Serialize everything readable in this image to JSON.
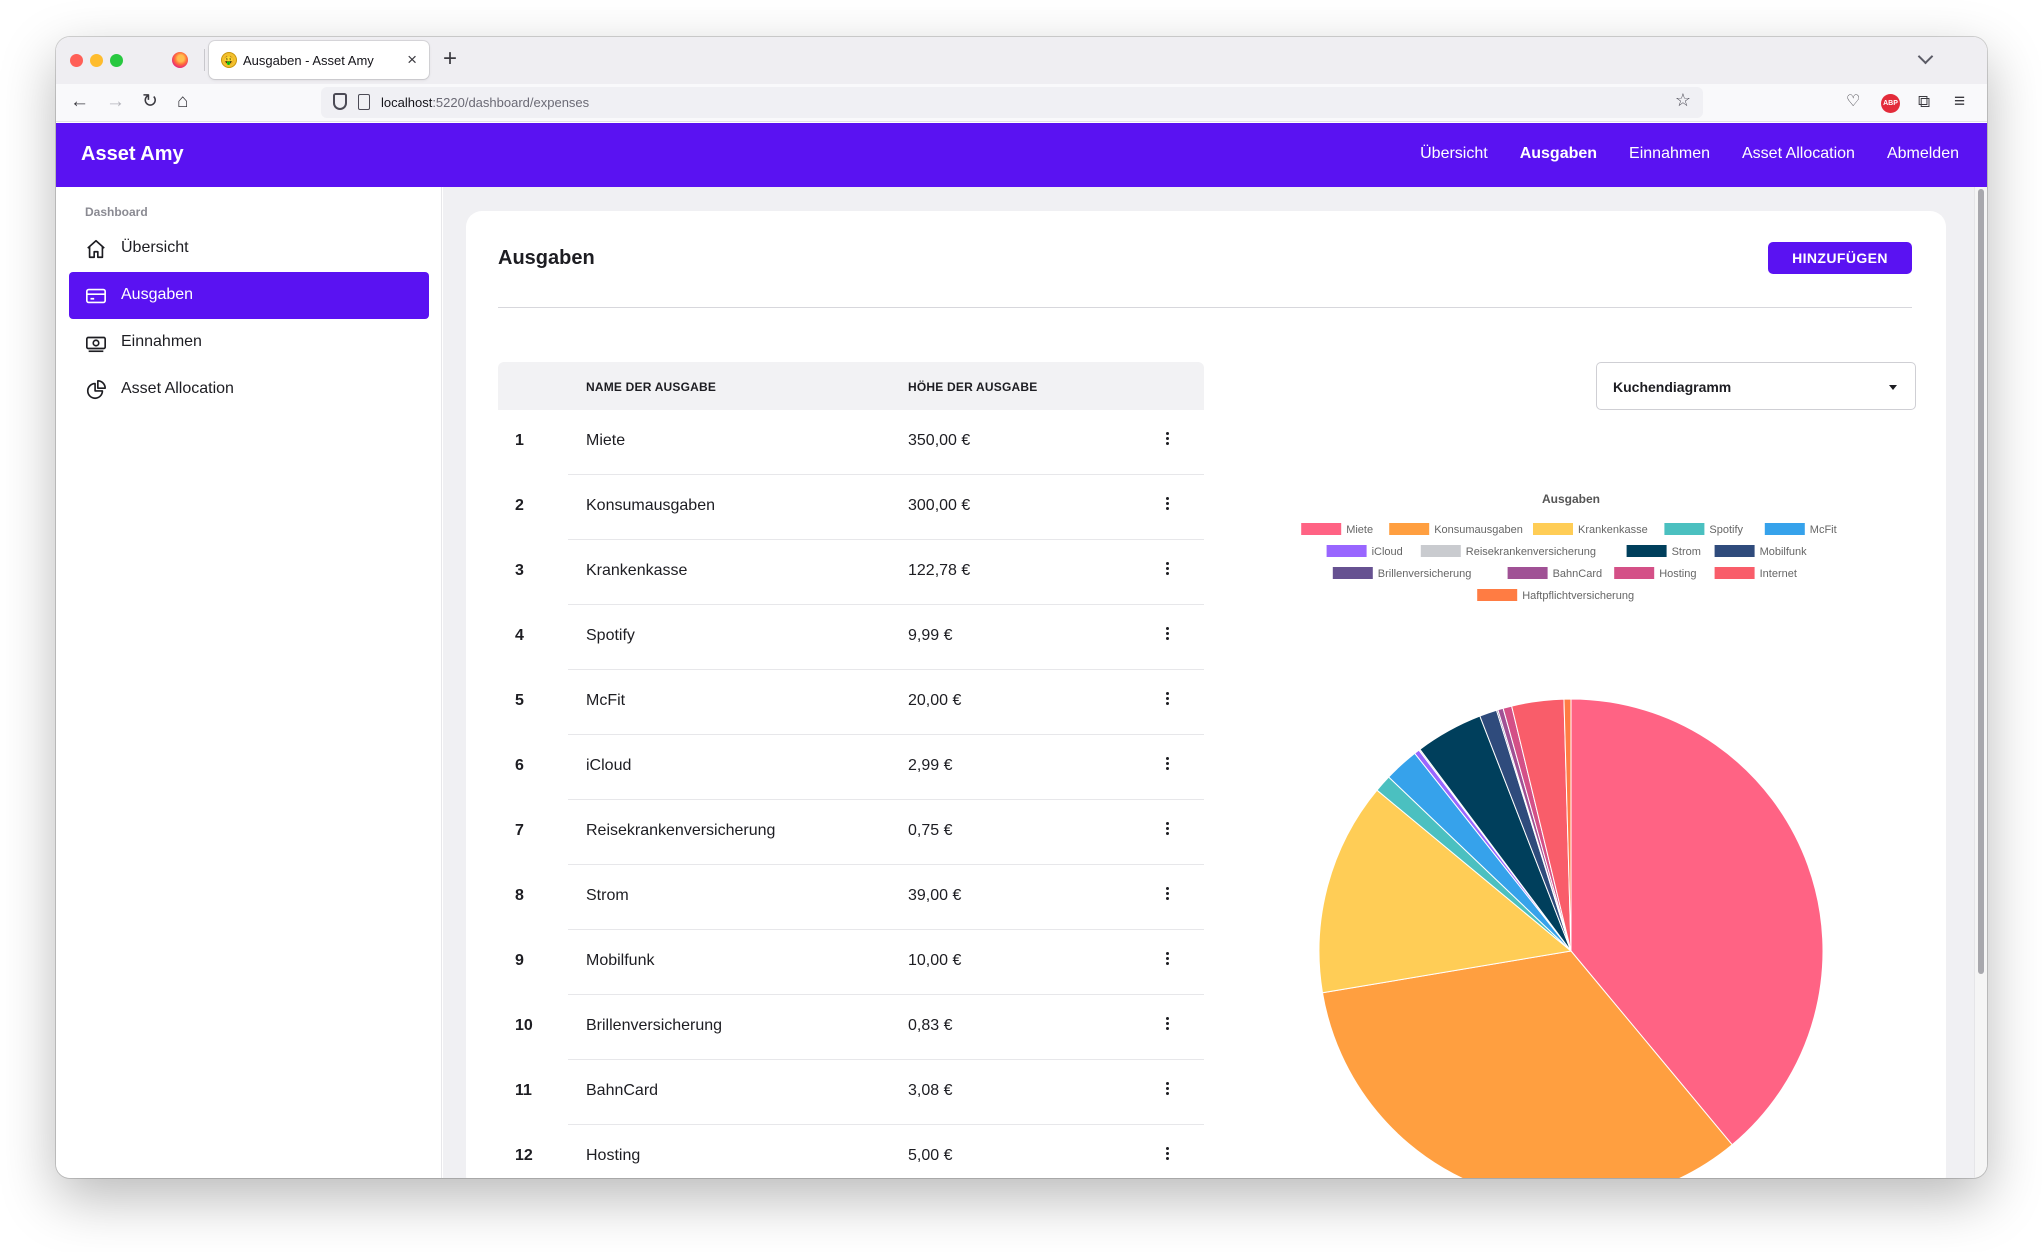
{
  "browser": {
    "tab_title": "Ausgaben - Asset Amy",
    "tab_favicon": "🤑",
    "url_host": "localhost",
    "url_path": ":5220/dashboard/expenses"
  },
  "app": {
    "brand": "Asset Amy",
    "topnav": [
      "Übersicht",
      "Ausgaben",
      "Einnahmen",
      "Asset Allocation",
      "Abmelden"
    ],
    "topnav_active": "Ausgaben"
  },
  "sidebar": {
    "heading": "Dashboard",
    "items": [
      {
        "label": "Übersicht",
        "icon": "home-icon",
        "active": false
      },
      {
        "label": "Ausgaben",
        "icon": "credit-card-icon",
        "active": true
      },
      {
        "label": "Einnahmen",
        "icon": "banknote-icon",
        "active": false
      },
      {
        "label": "Asset Allocation",
        "icon": "pie-chart-icon",
        "active": false
      }
    ]
  },
  "page": {
    "title": "Ausgaben",
    "add_button": "HINZUFÜGEN"
  },
  "table": {
    "col_name": "NAME DER AUSGABE",
    "col_amount": "HÖHE DER AUSGABE",
    "rows": [
      {
        "num": "1",
        "name": "Miete",
        "amount": "350,00 €"
      },
      {
        "num": "2",
        "name": "Konsumausgaben",
        "amount": "300,00 €"
      },
      {
        "num": "3",
        "name": "Krankenkasse",
        "amount": "122,78 €"
      },
      {
        "num": "4",
        "name": "Spotify",
        "amount": "9,99 €"
      },
      {
        "num": "5",
        "name": "McFit",
        "amount": "20,00 €"
      },
      {
        "num": "6",
        "name": "iCloud",
        "amount": "2,99 €"
      },
      {
        "num": "7",
        "name": "Reisekrankenversicherung",
        "amount": "0,75 €"
      },
      {
        "num": "8",
        "name": "Strom",
        "amount": "39,00 €"
      },
      {
        "num": "9",
        "name": "Mobilfunk",
        "amount": "10,00 €"
      },
      {
        "num": "10",
        "name": "Brillenversicherung",
        "amount": "0,83 €"
      },
      {
        "num": "11",
        "name": "BahnCard",
        "amount": "3,08 €"
      },
      {
        "num": "12",
        "name": "Hosting",
        "amount": "5,00 €"
      }
    ]
  },
  "chart_select": {
    "value": "Kuchendiagramm"
  },
  "chart_data": {
    "type": "pie",
    "title": "Ausgaben",
    "legend": "top",
    "slices": [
      {
        "label": "Miete",
        "value": 350.0,
        "color": "#ff6384"
      },
      {
        "label": "Konsumausgaben",
        "value": 300.0,
        "color": "#ff9f40"
      },
      {
        "label": "Krankenkasse",
        "value": 122.78,
        "color": "#ffcd56"
      },
      {
        "label": "Spotify",
        "value": 9.99,
        "color": "#4bc0c0"
      },
      {
        "label": "McFit",
        "value": 20.0,
        "color": "#36a2eb"
      },
      {
        "label": "iCloud",
        "value": 2.99,
        "color": "#9966ff"
      },
      {
        "label": "Reisekrankenversicherung",
        "value": 0.75,
        "color": "#c9cbcf"
      },
      {
        "label": "Strom",
        "value": 39.0,
        "color": "#003f5c"
      },
      {
        "label": "Mobilfunk",
        "value": 10.0,
        "color": "#2f4b7c"
      },
      {
        "label": "Brillenversicherung",
        "value": 0.83,
        "color": "#665191"
      },
      {
        "label": "BahnCard",
        "value": 3.08,
        "color": "#a05195"
      },
      {
        "label": "Hosting",
        "value": 5.0,
        "color": "#d45087"
      },
      {
        "label": "Internet",
        "value": 30.0,
        "color": "#f95d6a"
      },
      {
        "label": "Haftpflichtversicherung",
        "value": 4.0,
        "color": "#ff7c43"
      }
    ]
  }
}
